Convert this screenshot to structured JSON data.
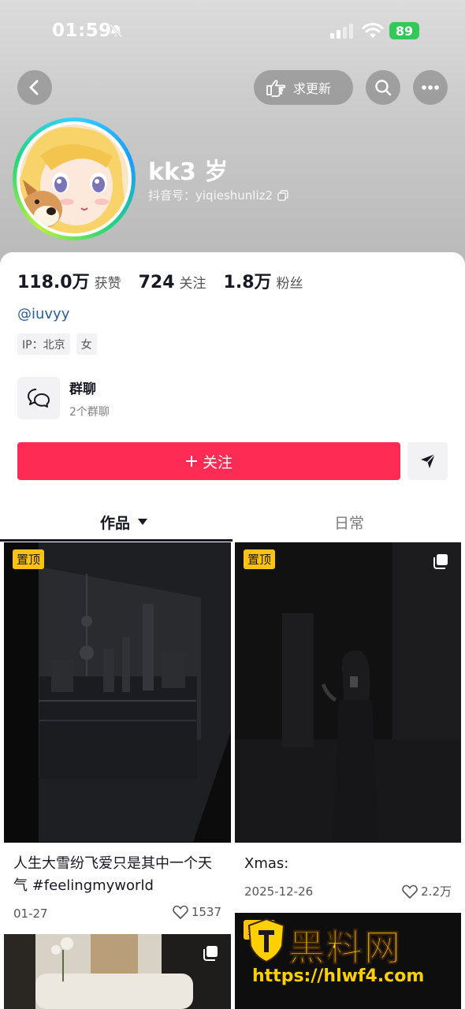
{
  "status_bar": {
    "time": "01:59",
    "battery": "89"
  },
  "header": {
    "update_button": "求更新",
    "username": "kk3 岁",
    "douyin_id": "抖音号：yiqieshunliz2"
  },
  "stats": [
    {
      "value": "118.0万",
      "label": "获赞"
    },
    {
      "value": "724",
      "label": "关注"
    },
    {
      "value": "1.8万",
      "label": "粉丝"
    }
  ],
  "profile": {
    "handle": "@iuvyy",
    "tags": [
      "IP：北京",
      "女"
    ]
  },
  "group_chat": {
    "title": "群聊",
    "subtitle": "2个群聊"
  },
  "follow_button": "关注",
  "tabs": {
    "works": "作品",
    "daily": "日常"
  },
  "posts": [
    {
      "pin": "置顶",
      "caption": "人生大雪纷飞爱只是其中一个天气 #feelingmyworld",
      "date": "01-27",
      "likes": "1537"
    },
    {
      "pin": "置顶",
      "caption": "Xmas:",
      "date": "2025-12-26",
      "likes": "2.2万"
    },
    {
      "pin": "",
      "caption": "",
      "date": "",
      "likes": ""
    },
    {
      "pin": "置顶",
      "caption": "",
      "date": "",
      "likes": ""
    }
  ],
  "watermark": {
    "brand": "黑料网",
    "url": "https://hlwf4.com"
  },
  "colors": {
    "accent": "#fe2c55",
    "pin": "#ffc30f",
    "link": "#2a5d9c",
    "battery": "#34c759"
  }
}
